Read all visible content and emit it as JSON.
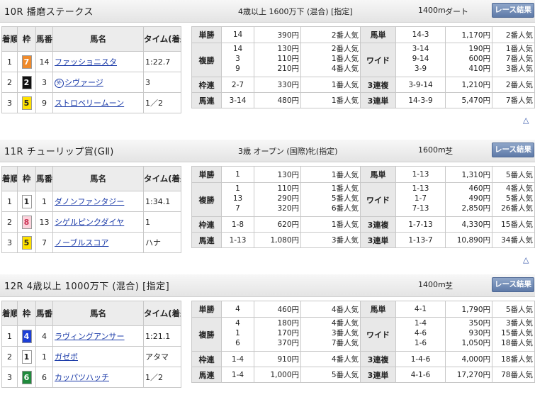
{
  "races": [
    {
      "title": "10R 播磨ステークス",
      "conditions": "4歳以上 1600万下 (混合) [指定]",
      "distance": "1400m",
      "track": "ダート",
      "result_button": "レース結果",
      "table_headers": [
        "着順",
        "枠",
        "馬番",
        "馬名",
        "タイム(着差)"
      ],
      "rows": [
        {
          "pos": "1",
          "waku": "7",
          "num": "14",
          "name": "ファッショニスタ",
          "mark": "",
          "time": "1:22.7"
        },
        {
          "pos": "2",
          "waku": "2",
          "num": "3",
          "name": "シヴァージ",
          "mark": "外",
          "time": "3"
        },
        {
          "pos": "3",
          "waku": "5",
          "num": "9",
          "name": "ストロベリームーン",
          "mark": "",
          "time": "1／2"
        }
      ],
      "payout": {
        "tansho": {
          "label": "単勝",
          "combo": "14",
          "pay": "390円",
          "pop": "2番人気"
        },
        "fukusho": {
          "label": "複勝",
          "combos": [
            "14",
            "3",
            "9"
          ],
          "pays": [
            "130円",
            "110円",
            "210円"
          ],
          "pops": [
            "2番人気",
            "1番人気",
            "4番人気"
          ]
        },
        "wakuren": {
          "label": "枠連",
          "combo": "2-7",
          "pay": "330円",
          "pop": "1番人気"
        },
        "umaren": {
          "label": "馬連",
          "combo": "3-14",
          "pay": "480円",
          "pop": "1番人気"
        },
        "umatan": {
          "label": "馬単",
          "combo": "14-3",
          "pay": "1,170円",
          "pop": "2番人気"
        },
        "wide": {
          "label": "ワイド",
          "combos": [
            "3-14",
            "9-14",
            "3-9"
          ],
          "pays": [
            "190円",
            "600円",
            "410円"
          ],
          "pops": [
            "1番人気",
            "7番人気",
            "3番人気"
          ]
        },
        "sanrenpuku": {
          "label": "3連複",
          "combo": "3-9-14",
          "pay": "1,210円",
          "pop": "2番人気"
        },
        "sanrentan": {
          "label": "3連単",
          "combo": "14-3-9",
          "pay": "5,470円",
          "pop": "7番人気"
        }
      },
      "colors": {
        "waku": [
          "#f08a2a",
          "#111111",
          "#ffe100"
        ],
        "waku_text": [
          "#ffffff",
          "#ffffff",
          "#222222"
        ]
      }
    },
    {
      "title": "11R チューリップ賞(GⅡ)",
      "conditions": "3歳 オープン (国際)牝(指定)",
      "distance": "1600m",
      "track": "芝",
      "result_button": "レース結果",
      "table_headers": [
        "着順",
        "枠",
        "馬番",
        "馬名",
        "タイム(着差)"
      ],
      "rows": [
        {
          "pos": "1",
          "waku": "1",
          "num": "1",
          "name": "ダノンファンタジー",
          "mark": "",
          "time": "1:34.1"
        },
        {
          "pos": "2",
          "waku": "8",
          "num": "13",
          "name": "シゲルピンクダイヤ",
          "mark": "",
          "time": "1"
        },
        {
          "pos": "3",
          "waku": "5",
          "num": "7",
          "name": "ノーブルスコア",
          "mark": "",
          "time": "ハナ"
        }
      ],
      "payout": {
        "tansho": {
          "label": "単勝",
          "combo": "1",
          "pay": "130円",
          "pop": "1番人気"
        },
        "fukusho": {
          "label": "複勝",
          "combos": [
            "1",
            "13",
            "7"
          ],
          "pays": [
            "110円",
            "290円",
            "320円"
          ],
          "pops": [
            "1番人気",
            "5番人気",
            "6番人気"
          ]
        },
        "wakuren": {
          "label": "枠連",
          "combo": "1-8",
          "pay": "620円",
          "pop": "1番人気"
        },
        "umaren": {
          "label": "馬連",
          "combo": "1-13",
          "pay": "1,080円",
          "pop": "3番人気"
        },
        "umatan": {
          "label": "馬単",
          "combo": "1-13",
          "pay": "1,310円",
          "pop": "5番人気"
        },
        "wide": {
          "label": "ワイド",
          "combos": [
            "1-13",
            "1-7",
            "7-13"
          ],
          "pays": [
            "460円",
            "490円",
            "2,850円"
          ],
          "pops": [
            "4番人気",
            "5番人気",
            "26番人気"
          ]
        },
        "sanrenpuku": {
          "label": "3連複",
          "combo": "1-7-13",
          "pay": "4,330円",
          "pop": "15番人気"
        },
        "sanrentan": {
          "label": "3連単",
          "combo": "1-13-7",
          "pay": "10,890円",
          "pop": "34番人気"
        }
      },
      "colors": {
        "waku": [
          "#ffffff",
          "#fbd3dc",
          "#ffe100"
        ],
        "waku_text": [
          "#222222",
          "#cc3355",
          "#222222"
        ]
      }
    },
    {
      "title": "12R 4歳以上 1000万下 (混合) [指定]",
      "conditions": "",
      "distance": "1400m",
      "track": "芝",
      "result_button": "レース結果",
      "table_headers": [
        "着順",
        "枠",
        "馬番",
        "馬名",
        "タイム(着差)"
      ],
      "rows": [
        {
          "pos": "1",
          "waku": "4",
          "num": "4",
          "name": "ラヴィングアンサー",
          "mark": "",
          "time": "1:21.1"
        },
        {
          "pos": "2",
          "waku": "1",
          "num": "1",
          "name": "ガゼボ",
          "mark": "",
          "time": "アタマ"
        },
        {
          "pos": "3",
          "waku": "6",
          "num": "6",
          "name": "カッパツハッチ",
          "mark": "",
          "time": "1／2"
        }
      ],
      "payout": {
        "tansho": {
          "label": "単勝",
          "combo": "4",
          "pay": "460円",
          "pop": "4番人気"
        },
        "fukusho": {
          "label": "複勝",
          "combos": [
            "4",
            "1",
            "6"
          ],
          "pays": [
            "180円",
            "170円",
            "370円"
          ],
          "pops": [
            "4番人気",
            "3番人気",
            "7番人気"
          ]
        },
        "wakuren": {
          "label": "枠連",
          "combo": "1-4",
          "pay": "910円",
          "pop": "4番人気"
        },
        "umaren": {
          "label": "馬連",
          "combo": "1-4",
          "pay": "1,000円",
          "pop": "5番人気"
        },
        "umatan": {
          "label": "馬単",
          "combo": "4-1",
          "pay": "1,790円",
          "pop": "5番人気"
        },
        "wide": {
          "label": "ワイド",
          "combos": [
            "1-4",
            "4-6",
            "1-6"
          ],
          "pays": [
            "350円",
            "930円",
            "1,050円"
          ],
          "pops": [
            "3番人気",
            "15番人気",
            "18番人気"
          ]
        },
        "sanrenpuku": {
          "label": "3連複",
          "combo": "1-4-6",
          "pay": "4,000円",
          "pop": "18番人気"
        },
        "sanrentan": {
          "label": "3連単",
          "combo": "4-1-6",
          "pay": "17,270円",
          "pop": "78番人気"
        }
      },
      "colors": {
        "waku": [
          "#1d3fd6",
          "#ffffff",
          "#1f8a3c"
        ],
        "waku_text": [
          "#ffffff",
          "#222222",
          "#ffffff"
        ]
      }
    }
  ],
  "page_top_icons": [
    "△",
    "△"
  ]
}
